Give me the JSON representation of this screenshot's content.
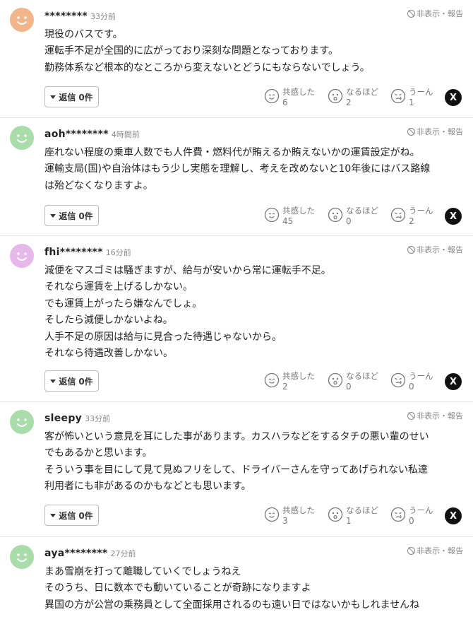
{
  "ui": {
    "hide_report": "非表示・報告",
    "reply_label": "返信",
    "reaction_labels": {
      "empathy": "共感した",
      "insight": "なるほど",
      "hmm": "うーん"
    },
    "share_x": "X"
  },
  "colors": {
    "avatar_orange": "#f2b489",
    "avatar_green": "#a8dca8",
    "avatar_pink": "#e6b8ea"
  },
  "comments": [
    {
      "username": "********",
      "time": "33分前",
      "avatar_color": "#f2b489",
      "lines": [
        "現役のバスです。",
        "運転手不足が全国的に広がっており深刻な問題となっております。",
        "勤務体系など根本的なところから変えないとどうにもならないでしょう。"
      ],
      "reply_count": "0件",
      "reactions": {
        "empathy": "6",
        "insight": "2",
        "hmm": "1"
      }
    },
    {
      "username": "aoh********",
      "time": "4時間前",
      "avatar_color": "#a8dca8",
      "lines": [
        "座れない程度の乗車人数でも人件費・燃料代が賄えるか賄えないかの運賃設定がね。",
        "運輸支局(国)や自治体はもう少し実態を理解し、考えを改めないと10年後にはバス路線",
        "は殆どなくなりますよ。"
      ],
      "reply_count": "0件",
      "reactions": {
        "empathy": "45",
        "insight": "0",
        "hmm": "2"
      }
    },
    {
      "username": "fhi********",
      "time": "16分前",
      "avatar_color": "#e6b8ea",
      "lines": [
        "減便をマスゴミは騒ぎますが、給与が安いから常に運転手不足。",
        "それなら運賃を上げるしかない。",
        "でも運賃上がったら嫌なんでしょ。",
        "そしたら減便しかないよね。",
        "人手不足の原因は給与に見合った待遇じゃないから。",
        "それなら待遇改善しかない。"
      ],
      "reply_count": "0件",
      "reactions": {
        "empathy": "2",
        "insight": "0",
        "hmm": "0"
      }
    },
    {
      "username": "sleepy",
      "time": "33分前",
      "avatar_color": "#a8dca8",
      "lines": [
        "客が怖いという意見を耳にした事があります。カスハラなどをするタチの悪い輩のせい",
        "でもあるかと思います。",
        "そういう事を目にして見て見ぬフリをして、ドライバーさんを守ってあげられない私達",
        "利用者にも非があるのかもなどとも思います。"
      ],
      "reply_count": "0件",
      "reactions": {
        "empathy": "3",
        "insight": "1",
        "hmm": "0"
      }
    },
    {
      "username": "aya********",
      "time": "27分前",
      "avatar_color": "#a8dca8",
      "lines": [
        "まあ雪崩を打って離職していくでしょうねえ",
        "そのうち、日に数本でも動いていることが奇跡になりますよ",
        "異国の方が公営の乗務員として全面採用されるのも遠い日ではないかもしれませんね"
      ]
    }
  ]
}
